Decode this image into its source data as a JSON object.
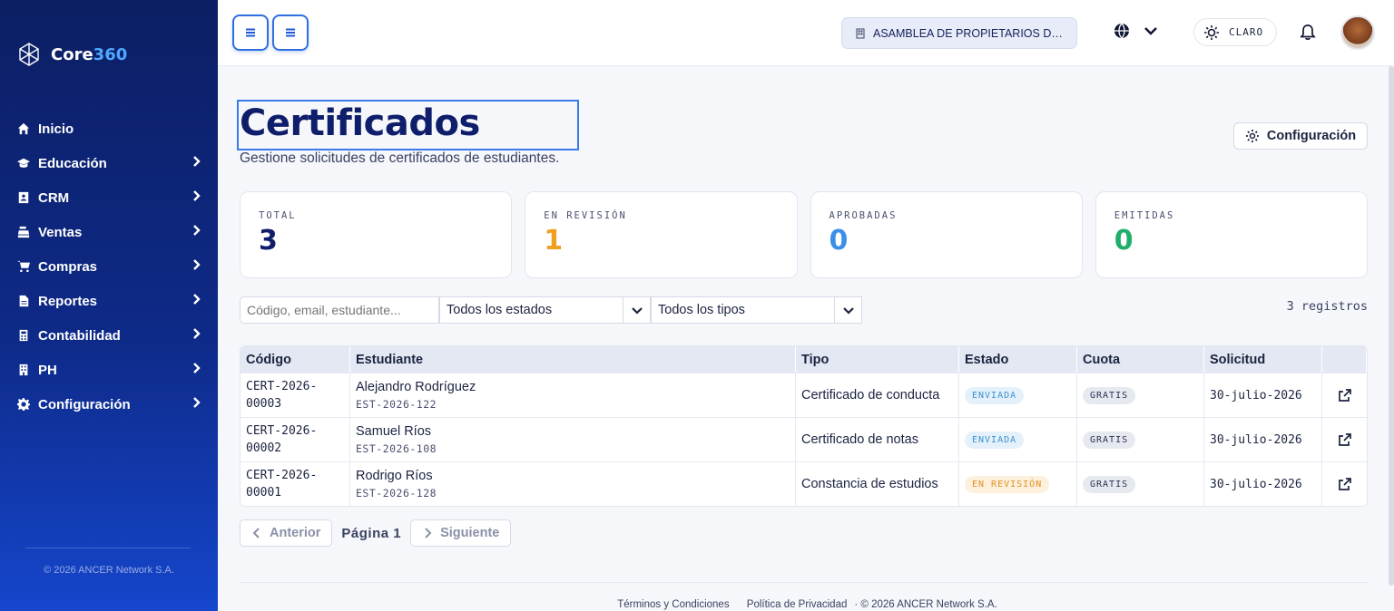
{
  "brand": {
    "prefix": "Core",
    "suffix": "360"
  },
  "sidebar": {
    "items": [
      {
        "label": "Inicio",
        "icon": "home-icon",
        "has_submenu": false
      },
      {
        "label": "Educación",
        "icon": "graduation-cap-icon",
        "has_submenu": true
      },
      {
        "label": "CRM",
        "icon": "address-book-icon",
        "has_submenu": true
      },
      {
        "label": "Ventas",
        "icon": "cash-register-icon",
        "has_submenu": true
      },
      {
        "label": "Compras",
        "icon": "shopping-cart-icon",
        "has_submenu": true
      },
      {
        "label": "Reportes",
        "icon": "report-file-icon",
        "has_submenu": true
      },
      {
        "label": "Contabilidad",
        "icon": "calculator-icon",
        "has_submenu": true
      },
      {
        "label": "PH",
        "icon": "building-icon",
        "has_submenu": true
      },
      {
        "label": "Configuración",
        "icon": "gear-icon",
        "has_submenu": true
      }
    ],
    "footer": "© 2026 ANCER Network S.A."
  },
  "topbar": {
    "organization": "ASAMBLEA DE PROPIETARIOS DE ...",
    "theme_label": "CLARO"
  },
  "page": {
    "title": "Certificados",
    "subtitle": "Gestione solicitudes de certificados de estudiantes.",
    "config_button": "Configuración"
  },
  "stats": [
    {
      "label": "TOTAL",
      "value": "3",
      "color": "#0f1e6b"
    },
    {
      "label": "EN REVISIÓN",
      "value": "1",
      "color": "#f0a020"
    },
    {
      "label": "APROBADAS",
      "value": "0",
      "color": "#3b8fe8"
    },
    {
      "label": "EMITIDAS",
      "value": "0",
      "color": "#1fae6b"
    }
  ],
  "filters": {
    "search_placeholder": "Código, email, estudiante...",
    "status_selected": "Todos los estados",
    "type_selected": "Todos los tipos",
    "records": "3 registros"
  },
  "table": {
    "headers": {
      "codigo": "Código",
      "estudiante": "Estudiante",
      "tipo": "Tipo",
      "estado": "Estado",
      "cuota": "Cuota",
      "solicitud": "Solicitud"
    },
    "rows": [
      {
        "code_line1": "CERT-2026-",
        "code_line2": "00003",
        "student": "Alejandro Rodríguez",
        "student_id": "EST-2026-122",
        "type": "Certificado de conducta",
        "status": "ENVIADA",
        "fee": "GRATIS",
        "date": "30-julio-2026"
      },
      {
        "code_line1": "CERT-2026-",
        "code_line2": "00002",
        "student": "Samuel Ríos",
        "student_id": "EST-2026-108",
        "type": "Certificado de notas",
        "status": "ENVIADA",
        "fee": "GRATIS",
        "date": "30-julio-2026"
      },
      {
        "code_line1": "CERT-2026-",
        "code_line2": "00001",
        "student": "Rodrigo Ríos",
        "student_id": "EST-2026-128",
        "type": "Constancia de estudios",
        "status": "EN REVISIÓN",
        "fee": "GRATIS",
        "date": "30-julio-2026"
      }
    ]
  },
  "pagination": {
    "prev": "Anterior",
    "page": "Página 1",
    "next": "Siguiente"
  },
  "footer": {
    "terms": "Términos y Condiciones",
    "privacy": "Política de Privacidad",
    "copyright": "· © 2026 ANCER Network S.A."
  }
}
